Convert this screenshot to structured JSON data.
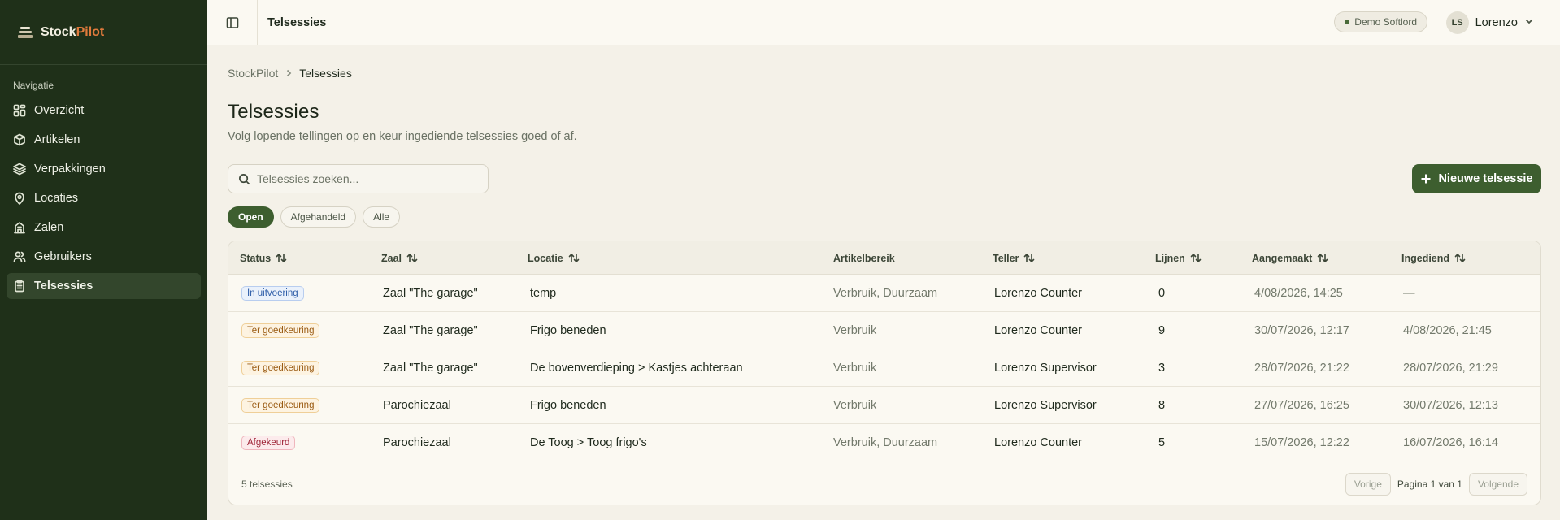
{
  "brand": {
    "name_main": "Stock",
    "name_accent": "Pilot",
    "accent_color": "#e07a3c"
  },
  "sidebar": {
    "title": "Navigatie",
    "items": [
      {
        "label": "Overzicht",
        "icon": "dashboard-icon"
      },
      {
        "label": "Artikelen",
        "icon": "box-icon"
      },
      {
        "label": "Verpakkingen",
        "icon": "layers-icon"
      },
      {
        "label": "Locaties",
        "icon": "map-pin-icon"
      },
      {
        "label": "Zalen",
        "icon": "building-icon"
      },
      {
        "label": "Gebruikers",
        "icon": "users-icon"
      },
      {
        "label": "Telsessies",
        "icon": "clipboard-icon",
        "active": true
      }
    ]
  },
  "topbar": {
    "title": "Telsessies",
    "org": "Demo Softlord",
    "user_initials": "LS",
    "user_name": "Lorenzo"
  },
  "breadcrumb": {
    "root": "StockPilot",
    "current": "Telsessies"
  },
  "page": {
    "title": "Telsessies",
    "subtitle": "Volg lopende tellingen op en keur ingediende telsessies goed of af."
  },
  "search": {
    "placeholder": "Telsessies zoeken...",
    "value": ""
  },
  "new_button": {
    "label": "Nieuwe telsessie"
  },
  "filters": {
    "open": "Open",
    "done": "Afgehandeld",
    "all": "Alle",
    "active": "Open"
  },
  "table": {
    "headers": {
      "status": "Status",
      "zaal": "Zaal",
      "locatie": "Locatie",
      "artikelbereik": "Artikelbereik",
      "teller": "Teller",
      "lijnen": "Lijnen",
      "aangemaakt": "Aangemaakt",
      "ingediend": "Ingediend"
    },
    "rows": [
      {
        "status": "In uitvoering",
        "zaal": "Zaal \"The garage\"",
        "locatie": "temp",
        "artikelbereik": "Verbruik, Duurzaam",
        "teller": "Lorenzo Counter",
        "lijnen": "0",
        "aangemaakt": "4/08/2026, 14:25",
        "ingediend": "—"
      },
      {
        "status": "Ter goedkeuring",
        "zaal": "Zaal \"The garage\"",
        "locatie": "Frigo beneden",
        "artikelbereik": "Verbruik",
        "teller": "Lorenzo Counter",
        "lijnen": "9",
        "aangemaakt": "30/07/2026, 12:17",
        "ingediend": "4/08/2026, 21:45"
      },
      {
        "status": "Ter goedkeuring",
        "zaal": "Zaal \"The garage\"",
        "locatie": "De bovenverdieping > Kastjes achteraan",
        "artikelbereik": "Verbruik",
        "teller": "Lorenzo Supervisor",
        "lijnen": "3",
        "aangemaakt": "28/07/2026, 21:22",
        "ingediend": "28/07/2026, 21:29"
      },
      {
        "status": "Ter goedkeuring",
        "zaal": "Parochiezaal",
        "locatie": "Frigo beneden",
        "artikelbereik": "Verbruik",
        "teller": "Lorenzo Supervisor",
        "lijnen": "8",
        "aangemaakt": "27/07/2026, 16:25",
        "ingediend": "30/07/2026, 12:13"
      },
      {
        "status": "Afgekeurd",
        "zaal": "Parochiezaal",
        "locatie": "De Toog > Toog frigo's",
        "artikelbereik": "Verbruik, Duurzaam",
        "teller": "Lorenzo Counter",
        "lijnen": "5",
        "aangemaakt": "15/07/2026, 12:22",
        "ingediend": "16/07/2026, 16:14"
      }
    ],
    "count": "5 telsessies",
    "prev": "Vorige",
    "page_info": "Pagina 1 van 1",
    "next": "Volgende"
  },
  "colors": {
    "sidebar_bg": "#1f3019",
    "primary": "#3d5e2f",
    "background": "#f4f1e8"
  }
}
